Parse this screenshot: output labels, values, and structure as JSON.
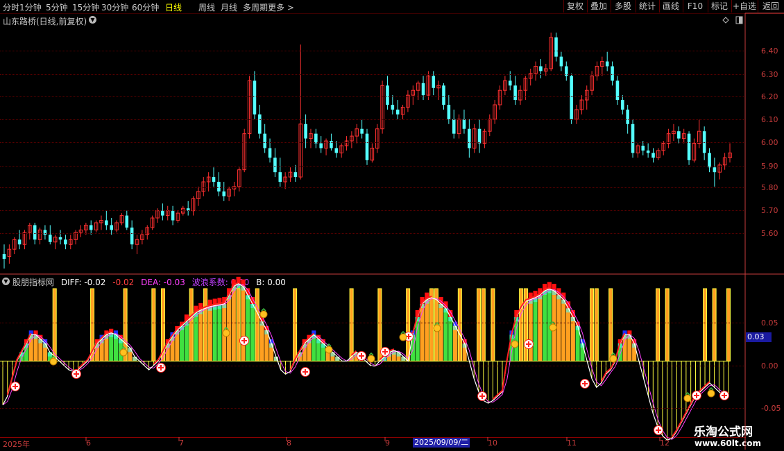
{
  "toolbar": {
    "timeframes": [
      "分时",
      "1分钟",
      "5分钟",
      "15分钟",
      "30分钟",
      "60分钟",
      "日线",
      "周线",
      "月线",
      "多周期",
      "更多 >"
    ],
    "active_timeframe": "日线",
    "right_buttons": [
      "复权",
      "叠加",
      "多股",
      "统计",
      "画线",
      "F10",
      "标记",
      "+自选",
      "返回"
    ]
  },
  "stock_title": "山东路桥(日线,前复权)",
  "price_axis": [
    "6.40",
    "6.30",
    "6.20",
    "6.10",
    "6.00",
    "5.90",
    "5.80",
    "5.70",
    "5.60"
  ],
  "indicator": {
    "name": "股朋指标网",
    "legend": [
      {
        "text": "DIFF: -0.02",
        "color": "#ffffff"
      },
      {
        "text": "-0.02",
        "color": "#ff4040"
      },
      {
        "text": "DEA: -0.03",
        "color": "#ff40ff"
      },
      {
        "text": "波浪系数: 0.00",
        "color": "#c040ff"
      },
      {
        "text": "B: 0.00",
        "color": "#ffffff"
      }
    ],
    "axis": [
      "0.05",
      "0.00",
      "-0.05"
    ],
    "current_value": "0.03"
  },
  "date_axis": {
    "labels": [
      "2025年",
      "6",
      "7",
      "8",
      "9",
      "10",
      "11",
      "12"
    ],
    "selected": "2025/09/09/二"
  },
  "watermark": {
    "title": "乐淘公式网",
    "url": "www.60lt.com"
  },
  "colors": {
    "up": "#ff3030",
    "down": "#54ffff",
    "axis": "#c83c3c",
    "grid": "#5a0000"
  },
  "chart_data": {
    "type": "candlestick",
    "ylim": [
      5.52,
      6.5
    ],
    "candles": [
      [
        5.56,
        5.6,
        5.5,
        5.54
      ],
      [
        5.55,
        5.6,
        5.52,
        5.58
      ],
      [
        5.58,
        5.63,
        5.56,
        5.62
      ],
      [
        5.62,
        5.66,
        5.58,
        5.6
      ],
      [
        5.6,
        5.66,
        5.58,
        5.65
      ],
      [
        5.65,
        5.69,
        5.62,
        5.68
      ],
      [
        5.68,
        5.69,
        5.6,
        5.62
      ],
      [
        5.62,
        5.67,
        5.6,
        5.66
      ],
      [
        5.66,
        5.68,
        5.62,
        5.64
      ],
      [
        5.64,
        5.68,
        5.6,
        5.61
      ],
      [
        5.61,
        5.64,
        5.58,
        5.63
      ],
      [
        5.63,
        5.66,
        5.6,
        5.62
      ],
      [
        5.62,
        5.64,
        5.58,
        5.6
      ],
      [
        5.6,
        5.64,
        5.58,
        5.62
      ],
      [
        5.62,
        5.66,
        5.6,
        5.65
      ],
      [
        5.65,
        5.68,
        5.63,
        5.66
      ],
      [
        5.66,
        5.69,
        5.64,
        5.68
      ],
      [
        5.68,
        5.7,
        5.64,
        5.66
      ],
      [
        5.66,
        5.7,
        5.65,
        5.69
      ],
      [
        5.69,
        5.72,
        5.66,
        5.7
      ],
      [
        5.7,
        5.74,
        5.66,
        5.68
      ],
      [
        5.68,
        5.71,
        5.64,
        5.66
      ],
      [
        5.66,
        5.7,
        5.65,
        5.69
      ],
      [
        5.69,
        5.73,
        5.68,
        5.72
      ],
      [
        5.72,
        5.74,
        5.66,
        5.67
      ],
      [
        5.67,
        5.7,
        5.58,
        5.6
      ],
      [
        5.6,
        5.64,
        5.56,
        5.62
      ],
      [
        5.62,
        5.66,
        5.6,
        5.64
      ],
      [
        5.64,
        5.68,
        5.62,
        5.67
      ],
      [
        5.67,
        5.72,
        5.66,
        5.71
      ],
      [
        5.71,
        5.75,
        5.69,
        5.74
      ],
      [
        5.74,
        5.77,
        5.7,
        5.72
      ],
      [
        5.72,
        5.76,
        5.7,
        5.74
      ],
      [
        5.74,
        5.76,
        5.68,
        5.7
      ],
      [
        5.7,
        5.74,
        5.69,
        5.73
      ],
      [
        5.73,
        5.76,
        5.72,
        5.75
      ],
      [
        5.75,
        5.78,
        5.72,
        5.74
      ],
      [
        5.74,
        5.8,
        5.72,
        5.79
      ],
      [
        5.79,
        5.84,
        5.76,
        5.82
      ],
      [
        5.82,
        5.88,
        5.8,
        5.86
      ],
      [
        5.86,
        5.9,
        5.82,
        5.88
      ],
      [
        5.88,
        5.92,
        5.84,
        5.86
      ],
      [
        5.86,
        5.9,
        5.8,
        5.82
      ],
      [
        5.82,
        5.86,
        5.78,
        5.8
      ],
      [
        5.8,
        5.84,
        5.78,
        5.83
      ],
      [
        5.83,
        5.86,
        5.8,
        5.84
      ],
      [
        5.84,
        5.92,
        5.82,
        5.91
      ],
      [
        5.91,
        6.08,
        5.9,
        6.06
      ],
      [
        6.06,
        6.3,
        6.04,
        6.28
      ],
      [
        6.28,
        6.32,
        6.12,
        6.14
      ],
      [
        6.14,
        6.18,
        6.04,
        6.06
      ],
      [
        6.06,
        6.1,
        5.98,
        6.0
      ],
      [
        6.0,
        6.04,
        5.94,
        5.96
      ],
      [
        5.96,
        6.0,
        5.88,
        5.9
      ],
      [
        5.9,
        5.96,
        5.84,
        5.86
      ],
      [
        5.86,
        5.9,
        5.83,
        5.88
      ],
      [
        5.88,
        5.92,
        5.86,
        5.9
      ],
      [
        5.9,
        5.93,
        5.86,
        5.88
      ],
      [
        5.88,
        6.43,
        5.87,
        6.1
      ],
      [
        6.1,
        6.14,
        6.0,
        6.04
      ],
      [
        6.04,
        6.08,
        6.0,
        6.06
      ],
      [
        6.06,
        6.08,
        6.0,
        6.02
      ],
      [
        6.02,
        6.05,
        5.98,
        6.0
      ],
      [
        6.0,
        6.04,
        5.97,
        6.03
      ],
      [
        6.03,
        6.06,
        5.99,
        6.0
      ],
      [
        6.0,
        6.03,
        5.96,
        5.98
      ],
      [
        5.98,
        6.02,
        5.96,
        6.01
      ],
      [
        6.01,
        6.05,
        5.99,
        6.03
      ],
      [
        6.03,
        6.07,
        6.0,
        6.05
      ],
      [
        6.05,
        6.1,
        6.02,
        6.08
      ],
      [
        6.08,
        6.12,
        6.04,
        6.06
      ],
      [
        6.06,
        6.08,
        5.93,
        5.95
      ],
      [
        5.95,
        6.02,
        5.94,
        6.0
      ],
      [
        6.0,
        6.1,
        5.98,
        6.08
      ],
      [
        6.08,
        6.28,
        6.06,
        6.26
      ],
      [
        6.26,
        6.3,
        6.16,
        6.18
      ],
      [
        6.18,
        6.22,
        6.14,
        6.16
      ],
      [
        6.16,
        6.2,
        6.12,
        6.14
      ],
      [
        6.14,
        6.18,
        6.12,
        6.17
      ],
      [
        6.17,
        6.24,
        6.15,
        6.22
      ],
      [
        6.22,
        6.26,
        6.18,
        6.24
      ],
      [
        6.24,
        6.28,
        6.2,
        6.27
      ],
      [
        6.27,
        6.3,
        6.2,
        6.22
      ],
      [
        6.22,
        6.32,
        6.2,
        6.3
      ],
      [
        6.3,
        6.32,
        6.22,
        6.25
      ],
      [
        6.25,
        6.28,
        6.2,
        6.26
      ],
      [
        6.26,
        6.27,
        6.16,
        6.18
      ],
      [
        6.18,
        6.22,
        6.1,
        6.12
      ],
      [
        6.12,
        6.16,
        6.04,
        6.06
      ],
      [
        6.06,
        6.14,
        6.04,
        6.12
      ],
      [
        6.12,
        6.16,
        6.06,
        6.08
      ],
      [
        6.08,
        6.12,
        5.96,
        6.0
      ],
      [
        6.0,
        6.1,
        5.98,
        6.08
      ],
      [
        6.08,
        6.12,
        5.98,
        6.02
      ],
      [
        6.02,
        6.08,
        6.0,
        6.07
      ],
      [
        6.07,
        6.14,
        6.05,
        6.12
      ],
      [
        6.12,
        6.2,
        6.1,
        6.18
      ],
      [
        6.18,
        6.26,
        6.16,
        6.24
      ],
      [
        6.24,
        6.3,
        6.22,
        6.28
      ],
      [
        6.28,
        6.32,
        6.24,
        6.26
      ],
      [
        6.26,
        6.3,
        6.18,
        6.2
      ],
      [
        6.2,
        6.26,
        6.18,
        6.24
      ],
      [
        6.24,
        6.3,
        6.2,
        6.29
      ],
      [
        6.29,
        6.33,
        6.26,
        6.31
      ],
      [
        6.31,
        6.36,
        6.28,
        6.34
      ],
      [
        6.34,
        6.37,
        6.29,
        6.32
      ],
      [
        6.32,
        6.35,
        6.3,
        6.33
      ],
      [
        6.33,
        6.48,
        6.32,
        6.46
      ],
      [
        6.46,
        6.48,
        6.36,
        6.38
      ],
      [
        6.38,
        6.4,
        6.32,
        6.34
      ],
      [
        6.34,
        6.36,
        6.28,
        6.3
      ],
      [
        6.3,
        6.31,
        6.1,
        6.12
      ],
      [
        6.12,
        6.18,
        6.1,
        6.16
      ],
      [
        6.16,
        6.22,
        6.14,
        6.2
      ],
      [
        6.2,
        6.26,
        6.16,
        6.24
      ],
      [
        6.24,
        6.32,
        6.22,
        6.3
      ],
      [
        6.3,
        6.36,
        6.28,
        6.34
      ],
      [
        6.34,
        6.38,
        6.3,
        6.36
      ],
      [
        6.36,
        6.4,
        6.32,
        6.34
      ],
      [
        6.34,
        6.36,
        6.26,
        6.28
      ],
      [
        6.28,
        6.3,
        6.18,
        6.2
      ],
      [
        6.2,
        6.22,
        6.14,
        6.16
      ],
      [
        6.16,
        6.18,
        6.06,
        6.1
      ],
      [
        6.1,
        6.12,
        5.96,
        5.98
      ],
      [
        5.98,
        6.02,
        5.96,
        6.01
      ],
      [
        6.01,
        6.03,
        5.97,
        5.99
      ],
      [
        5.99,
        6.02,
        5.96,
        5.98
      ],
      [
        5.98,
        6.0,
        5.94,
        5.96
      ],
      [
        5.96,
        6.0,
        5.95,
        5.99
      ],
      [
        5.99,
        6.03,
        5.97,
        6.02
      ],
      [
        6.02,
        6.08,
        6.0,
        6.06
      ],
      [
        6.06,
        6.1,
        6.03,
        6.07
      ],
      [
        6.07,
        6.09,
        6.02,
        6.04
      ],
      [
        6.04,
        6.08,
        6.02,
        6.06
      ],
      [
        6.06,
        6.07,
        5.93,
        5.95
      ],
      [
        5.95,
        6.04,
        5.94,
        6.02
      ],
      [
        6.02,
        6.12,
        6.0,
        6.07
      ],
      [
        6.07,
        6.09,
        5.95,
        5.98
      ],
      [
        5.98,
        6.0,
        5.9,
        5.92
      ],
      [
        5.92,
        5.96,
        5.84,
        5.9
      ],
      [
        5.9,
        5.94,
        5.87,
        5.93
      ],
      [
        5.93,
        5.98,
        5.91,
        5.96
      ],
      [
        5.96,
        6.02,
        5.94,
        5.98
      ]
    ],
    "indicator": {
      "diff": [
        -0.05,
        -0.04,
        -0.02,
        0.0,
        0.01,
        0.02,
        0.03,
        0.03,
        0.025,
        0.02,
        0.01,
        0.005,
        0.0,
        -0.005,
        -0.01,
        -0.012,
        -0.01,
        -0.005,
        0.0,
        0.01,
        0.02,
        0.025,
        0.03,
        0.032,
        0.03,
        0.025,
        0.02,
        0.015,
        0.005,
        0.0,
        -0.005,
        -0.01,
        -0.005,
        0.0,
        0.01,
        0.02,
        0.028,
        0.035,
        0.04,
        0.045,
        0.05,
        0.055,
        0.058,
        0.06,
        0.062,
        0.063,
        0.064,
        0.065,
        0.075,
        0.085,
        0.088,
        0.085,
        0.075,
        0.065,
        0.055,
        0.045,
        0.035,
        0.02,
        0.005,
        -0.01,
        -0.015,
        -0.012,
        0.0,
        0.01,
        0.02,
        0.025,
        0.03,
        0.025,
        0.02,
        0.015,
        0.01,
        0.005,
        0.0,
        0.0,
        0.005,
        0.01,
        0.005,
        0.0,
        -0.005,
        -0.006,
        0.0,
        0.005,
        0.01,
        0.012,
        0.01,
        0.005,
        0.0,
        0.03,
        0.05,
        0.065,
        0.07,
        0.072,
        0.07,
        0.065,
        0.06,
        0.05,
        0.04,
        0.03,
        0.02,
        0.0,
        -0.02,
        -0.035,
        -0.045,
        -0.048,
        -0.045,
        -0.04,
        -0.035,
        0.0,
        0.03,
        0.05,
        0.06,
        0.068,
        0.07,
        0.072,
        0.075,
        0.08,
        0.082,
        0.08,
        0.075,
        0.07,
        0.06,
        0.05,
        0.04,
        0.02,
        0.0,
        -0.02,
        -0.03,
        -0.025,
        -0.015,
        -0.01,
        0.0,
        0.02,
        0.03,
        0.03,
        0.02,
        0.0,
        -0.02,
        -0.04,
        -0.06,
        -0.075,
        -0.085,
        -0.09,
        -0.088,
        -0.08,
        -0.07,
        -0.06,
        -0.05,
        -0.04,
        -0.035,
        -0.03,
        -0.025,
        -0.03,
        -0.035,
        -0.04,
        -0.04
      ],
      "y_range": [
        -0.085,
        0.095
      ],
      "axis_ticks": [
        0.05,
        0.0,
        -0.05
      ]
    }
  }
}
